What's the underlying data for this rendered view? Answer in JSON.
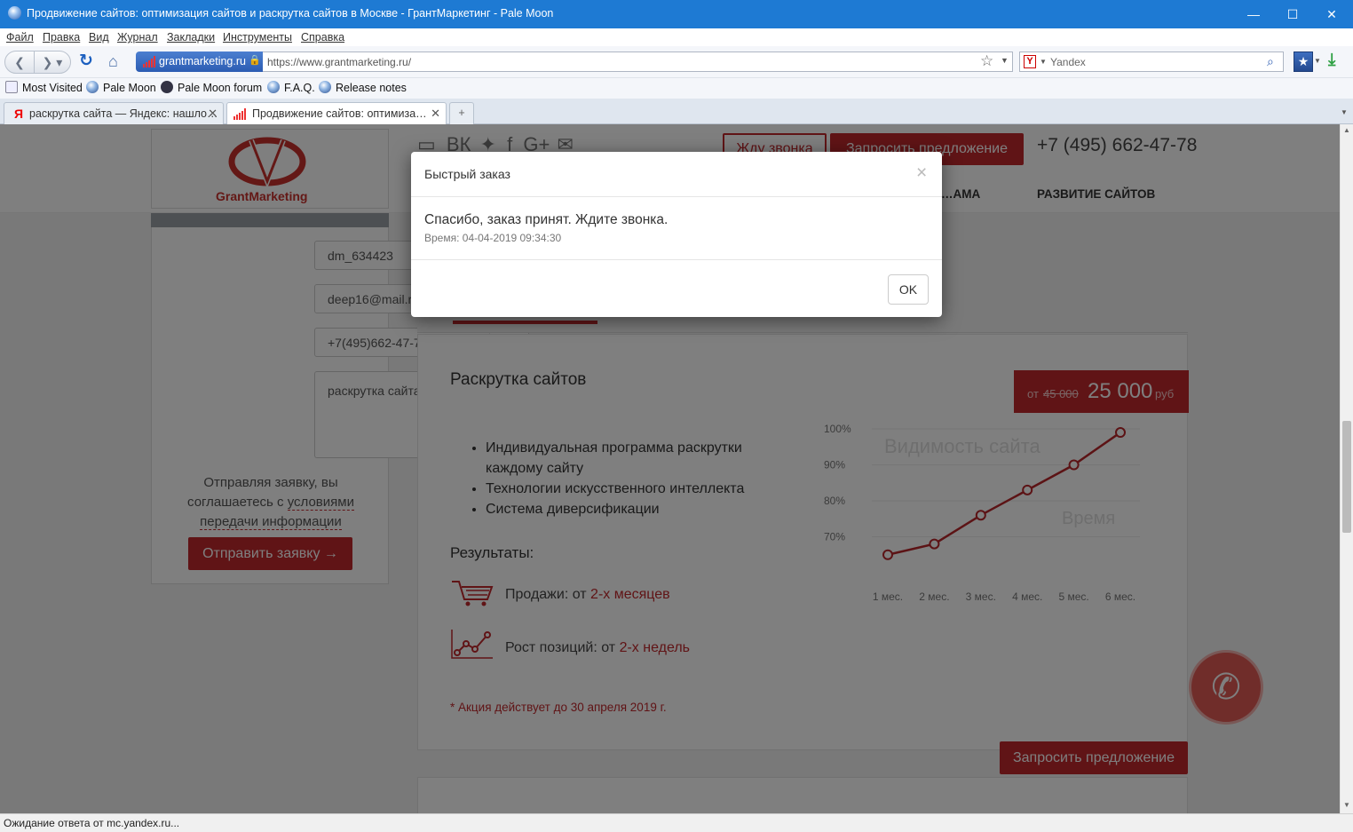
{
  "window": {
    "title": "Продвижение сайтов: оптимизация сайтов и раскрутка сайтов в Москве - ГрантМаркетинг - Pale Moon",
    "min": "—",
    "max": "☐",
    "close": "✕"
  },
  "menu": [
    "Файл",
    "Правка",
    "Вид",
    "Журнал",
    "Закладки",
    "Инструменты",
    "Справка"
  ],
  "nav": {
    "identity": "grantmarketing.ru",
    "url": "https://www.grantmarketing.ru/",
    "search_engine": "Yandex"
  },
  "bookmarks": [
    "Most Visited",
    "Pale Moon",
    "Pale Moon forum",
    "F.A.Q.",
    "Release notes"
  ],
  "tabs": [
    {
      "label": "раскрутка сайта — Яндекс: нашло…",
      "active": false
    },
    {
      "label": "Продвижение сайтов: оптимиза…",
      "active": true
    }
  ],
  "site": {
    "logo": "GrantMarketing",
    "call_button": "Жду звонка",
    "offer_button": "Запросить предложение",
    "phone": "+7 (495) 662-47-78",
    "nav_links": [
      "…АМА",
      "РАЗВИТИЕ САЙТОВ"
    ],
    "form": {
      "name": "dm_634423",
      "email": "deep16@mail.ru",
      "phone": "+7(495)662-47-78",
      "message": "раскрутка сайта",
      "consent_prefix": "Отправляя заявку, вы соглашаетесь с",
      "consent_link": "условиями передачи информации",
      "submit": "Отправить заявку"
    },
    "card": {
      "title": "Раскрутка сайтов",
      "bullets": [
        "Индивидуальная программа раскрутки каждому сайту",
        "Технологии искусственного интеллекта",
        "Система диверсификации"
      ],
      "price_prefix": "от",
      "old_price": "45 000",
      "price": "25 000",
      "currency": "руб",
      "results_title": "Результаты:",
      "result1_label": "Продажи: от",
      "result1_value": "2-х месяцев",
      "result2_label": "Рост позиций: от",
      "result2_value": "2-х недель",
      "promo": "* Акция действует до 30 апреля 2019 г.",
      "offer_button": "Запросить предложение"
    }
  },
  "chart_data": {
    "type": "line",
    "title": "Видимость сайта",
    "xlabel": "Время",
    "ylabel": "",
    "categories": [
      "1 мес.",
      "2 мес.",
      "3 мес.",
      "4 мес.",
      "5 мес.",
      "6 мес."
    ],
    "yticks": [
      "100%",
      "90%",
      "80%",
      "70%"
    ],
    "values": [
      65,
      68,
      76,
      83,
      90,
      99
    ],
    "ylim": [
      60,
      100
    ],
    "color": "#b8262b",
    "grid": true
  },
  "modal": {
    "title": "Быстрый заказ",
    "close": "×",
    "message": "Спасибо, заказ принят. Ждите звонка.",
    "time_label": "Время:",
    "time_value": "04-04-2019 09:34:30",
    "ok": "OK"
  },
  "status": "Ожидание ответа от mc.yandex.ru..."
}
